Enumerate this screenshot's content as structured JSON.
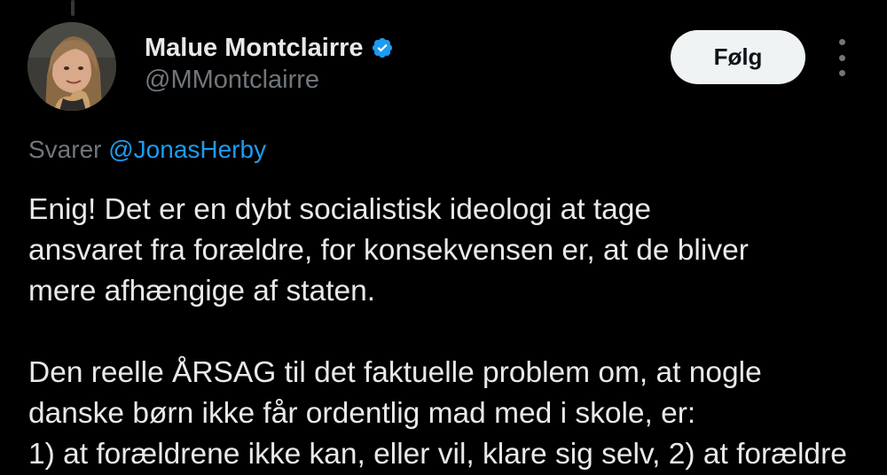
{
  "author": {
    "display_name": "Malue Montclairre",
    "handle": "@MMontclairre",
    "verified": true,
    "verified_color": "#1d9bf0"
  },
  "actions": {
    "follow_label": "Følg",
    "more_icon": "more-vertical-icon"
  },
  "reply": {
    "prefix": "Svarer",
    "mention": "@JonasHerby"
  },
  "tweet": {
    "paragraph1": [
      "Enig! Det er en dybt socialistisk ideologi at tage",
      "ansvaret fra forældre, for konsekvensen er, at de bliver",
      "mere afhængige af staten."
    ],
    "paragraph2": [
      "Den reelle ÅRSAG til det faktuelle problem om, at nogle",
      "danske børn ikke får ordentlig mad med i skole, er:",
      "1) at forældrene ikke kan, eller vil, klare sig selv, 2) at forældre"
    ]
  },
  "colors": {
    "background": "#000000",
    "text": "#e7e9ea",
    "secondary": "#71767b",
    "link": "#1d9bf0",
    "button_bg": "#eff3f4"
  }
}
